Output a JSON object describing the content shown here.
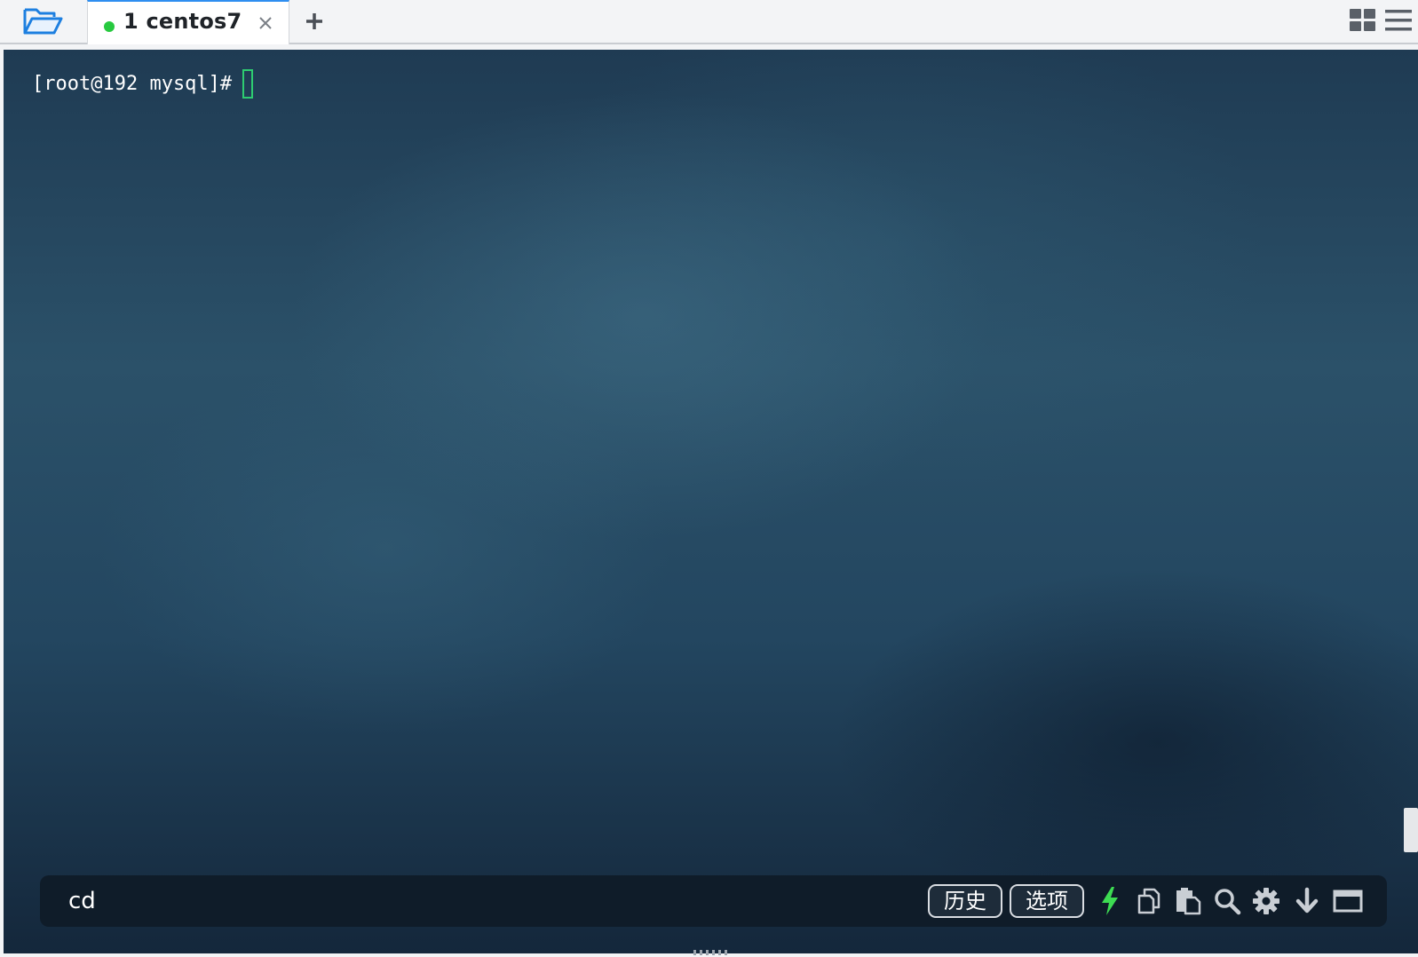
{
  "tabbar": {
    "tab": {
      "label": "1 centos7",
      "status_color": "#27c93f"
    },
    "icons": {
      "folder": "folder-open-icon",
      "close": "close-icon",
      "add": "plus-icon",
      "grid": "grid-layout-icon",
      "menu": "hamburger-menu-icon"
    }
  },
  "terminal": {
    "prompt": "[root@192 mysql]#",
    "cursor_color": "#2ecc71"
  },
  "command_bar": {
    "input_value": "cd",
    "buttons": {
      "history_label": "历史",
      "options_label": "选项"
    },
    "tools": [
      "flash-icon",
      "copy-icon",
      "paste-icon",
      "search-icon",
      "gear-icon",
      "arrow-down-icon",
      "window-icon"
    ],
    "flash_color": "#3ddc52"
  },
  "colors": {
    "accent": "#2f8ef0",
    "folder_icon": "#1d7fe0"
  }
}
